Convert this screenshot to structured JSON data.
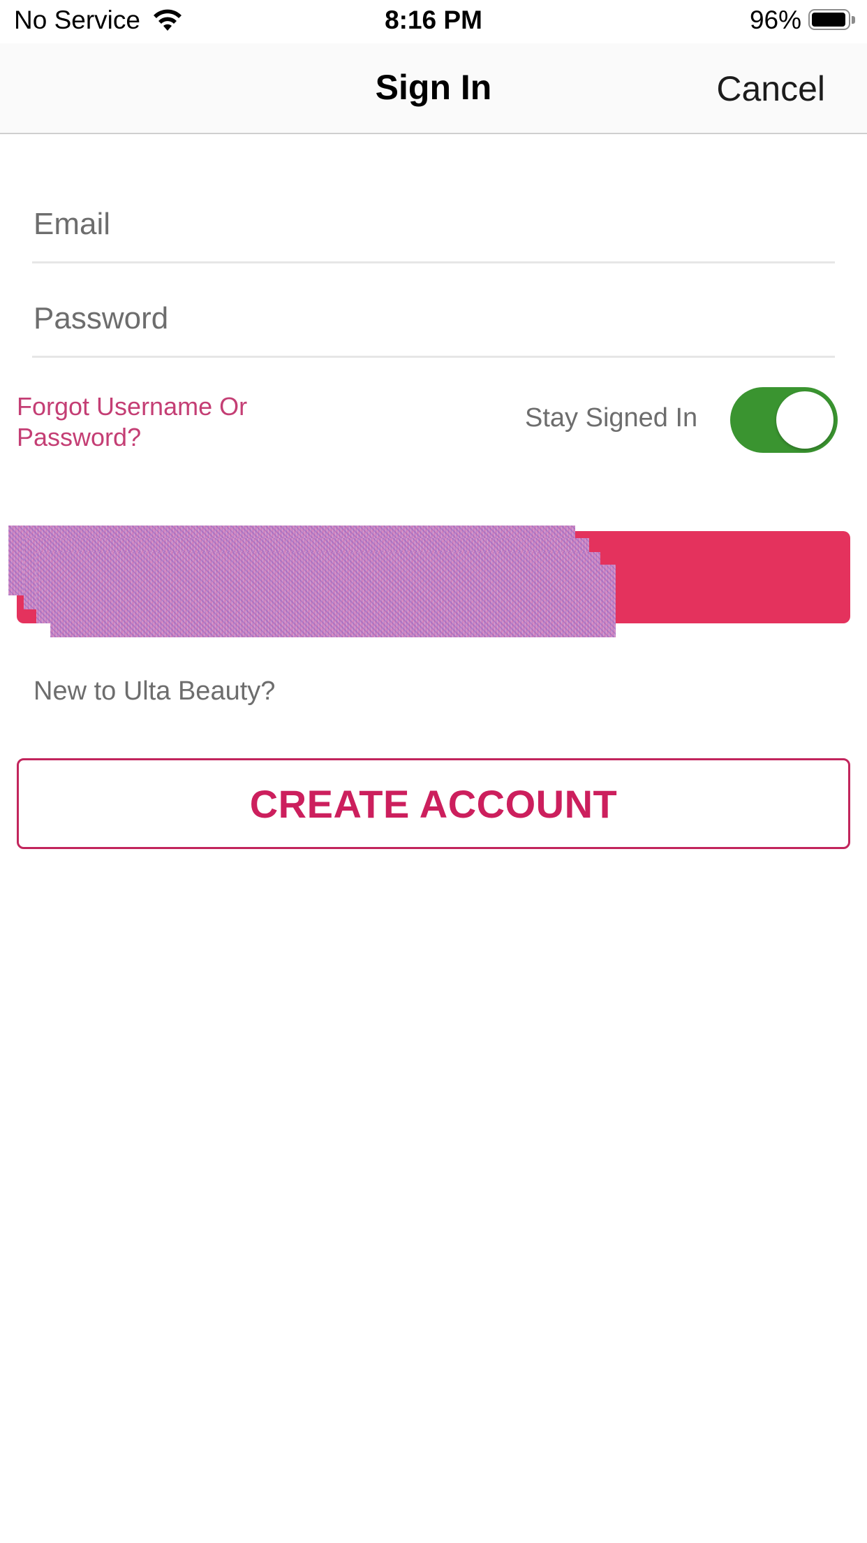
{
  "status_bar": {
    "carrier": "No Service",
    "time": "8:16 PM",
    "battery_percent": "96%",
    "battery_level": 0.96,
    "wifi_icon": "wifi-icon",
    "battery_icon": "battery-icon"
  },
  "nav": {
    "title": "Sign In",
    "cancel_label": "Cancel"
  },
  "form": {
    "email_placeholder": "Email",
    "email_value": "",
    "password_placeholder": "Password",
    "password_value": "",
    "forgot_link": "Forgot Username Or Password?",
    "stay_signed_in_label": "Stay Signed In",
    "stay_signed_in_on": true
  },
  "signin_button": {
    "label": ""
  },
  "register": {
    "prompt": "New to Ulta Beauty?",
    "create_account_label": "CREATE ACCOUNT"
  },
  "colors": {
    "accent": "#e4325d",
    "link": "#c43e74",
    "create_border": "#c2255c",
    "toggle_on": "#3a9430"
  }
}
